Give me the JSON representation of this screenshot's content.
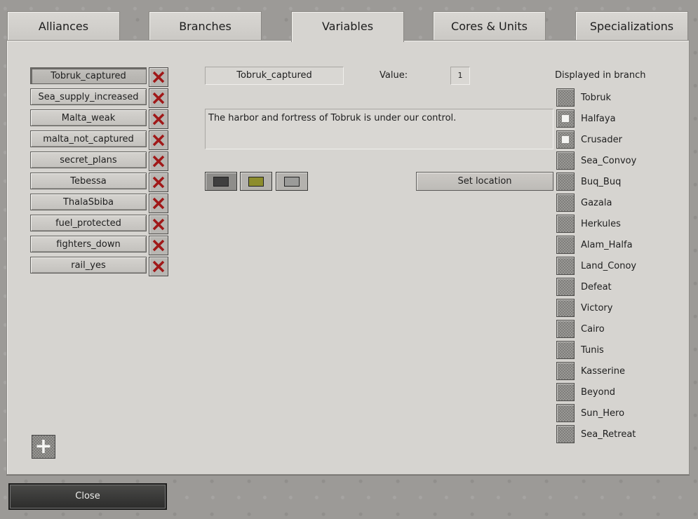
{
  "tabs": [
    {
      "label": "Alliances"
    },
    {
      "label": "Branches"
    },
    {
      "label": "Variables"
    },
    {
      "label": "Cores & Units"
    },
    {
      "label": "Specializations"
    }
  ],
  "active_tab": "Variables",
  "variables": [
    {
      "name": "Tobruk_captured",
      "selected": true
    },
    {
      "name": "Sea_supply_increased"
    },
    {
      "name": "Malta_weak"
    },
    {
      "name": "malta_not_captured"
    },
    {
      "name": "secret_plans"
    },
    {
      "name": "Tebessa"
    },
    {
      "name": "ThalaSbiba"
    },
    {
      "name": "fuel_protected"
    },
    {
      "name": "fighters_down"
    },
    {
      "name": "rail_yes"
    }
  ],
  "editor": {
    "name_value": "Tobruk_captured",
    "value_label": "Value:",
    "value": "1",
    "description": "The harbor and fortress of Tobruk is under our control.",
    "set_location_label": "Set location",
    "swatches": [
      {
        "name": "dark",
        "color": "#3f3f3f"
      },
      {
        "name": "olive",
        "color": "#8d8d2d"
      },
      {
        "name": "grey",
        "color": "#9b9b99"
      }
    ]
  },
  "branches": {
    "title": "Displayed in branch",
    "items": [
      {
        "label": "Tobruk",
        "checked": false
      },
      {
        "label": "Halfaya",
        "checked": true
      },
      {
        "label": "Crusader",
        "checked": true
      },
      {
        "label": "Sea_Convoy",
        "checked": false
      },
      {
        "label": "Buq_Buq",
        "checked": false
      },
      {
        "label": "Gazala",
        "checked": false
      },
      {
        "label": "Herkules",
        "checked": false
      },
      {
        "label": "Alam_Halfa",
        "checked": false
      },
      {
        "label": "Land_Conoy",
        "checked": false
      },
      {
        "label": "Defeat",
        "checked": false
      },
      {
        "label": "Victory",
        "checked": false
      },
      {
        "label": "Cairo",
        "checked": false
      },
      {
        "label": "Tunis",
        "checked": false
      },
      {
        "label": "Kasserine",
        "checked": false
      },
      {
        "label": "Beyond",
        "checked": false
      },
      {
        "label": "Sun_Hero",
        "checked": false
      },
      {
        "label": "Sea_Retreat",
        "checked": false
      }
    ]
  },
  "footer": {
    "close_label": "Close"
  },
  "colors": {
    "delete_x": "#a01818",
    "panel": "#d6d4d0"
  }
}
